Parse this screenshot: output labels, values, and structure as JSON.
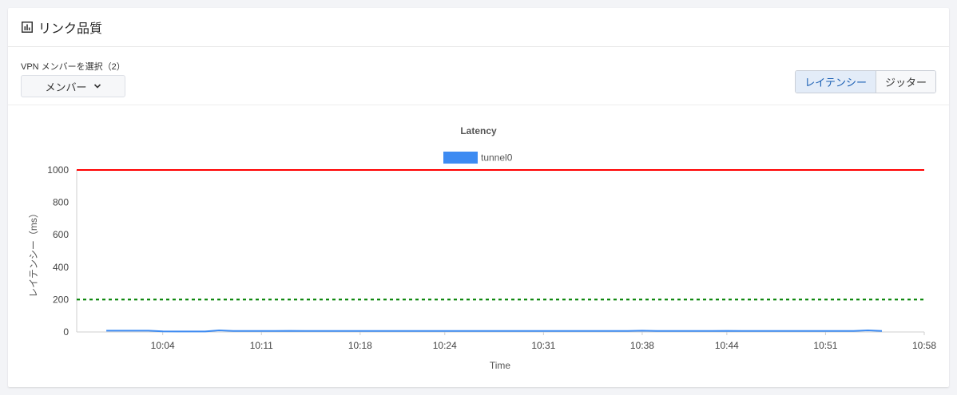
{
  "card": {
    "title": "リンク品質",
    "title_icon": "bar-chart-icon"
  },
  "member_select": {
    "label": "VPN メンバーを選択（2）",
    "button_label": "メンバー",
    "icon": "chevron-down-icon"
  },
  "metric_toggle": {
    "options": [
      "レイテンシー",
      "ジッター"
    ],
    "selected": "レイテンシー",
    "accent_color": "#1a5fb4"
  },
  "chart_data": {
    "type": "line",
    "title": "Latency",
    "xlabel": "Time",
    "ylabel": "レイテンシー（ms）",
    "ylim": [
      0,
      1000
    ],
    "y_ticks": [
      "0",
      "200",
      "400",
      "600",
      "800",
      "1000"
    ],
    "x_ticks": [
      "10:04",
      "10:11",
      "10:18",
      "10:24",
      "10:31",
      "10:38",
      "10:44",
      "10:51",
      "10:58"
    ],
    "legend_placement": "top-center",
    "series": [
      {
        "name": "tunnel0",
        "color": "#3d8bf2",
        "x": [
          "10:00",
          "10:01",
          "10:02",
          "10:03",
          "10:04",
          "10:05",
          "10:06",
          "10:07",
          "10:08",
          "10:09",
          "10:10",
          "10:11",
          "10:12",
          "10:13",
          "10:14",
          "10:15",
          "10:16",
          "10:17",
          "10:18",
          "10:19",
          "10:20",
          "10:21",
          "10:22",
          "10:23",
          "10:24",
          "10:25",
          "10:26",
          "10:27",
          "10:28",
          "10:29",
          "10:30",
          "10:31",
          "10:32",
          "10:33",
          "10:34",
          "10:35",
          "10:36",
          "10:37",
          "10:38",
          "10:39",
          "10:40",
          "10:41",
          "10:42",
          "10:43",
          "10:44",
          "10:45",
          "10:46",
          "10:47",
          "10:48",
          "10:49",
          "10:50",
          "10:51",
          "10:52",
          "10:53",
          "10:54",
          "10:55"
        ],
        "values": [
          8,
          8,
          8,
          8,
          4,
          3,
          3,
          3,
          10,
          6,
          6,
          6,
          6,
          7,
          6,
          6,
          6,
          6,
          6,
          6,
          6,
          6,
          6,
          6,
          6,
          6,
          6,
          6,
          6,
          6,
          6,
          6,
          6,
          6,
          6,
          6,
          6,
          6,
          8,
          6,
          6,
          6,
          6,
          6,
          7,
          6,
          6,
          6,
          6,
          6,
          6,
          6,
          6,
          6,
          10,
          6
        ]
      }
    ],
    "thresholds": [
      {
        "value": 1000,
        "color": "#ff0000",
        "style": "solid"
      },
      {
        "value": 200,
        "color": "#008000",
        "style": "dashed"
      }
    ]
  }
}
